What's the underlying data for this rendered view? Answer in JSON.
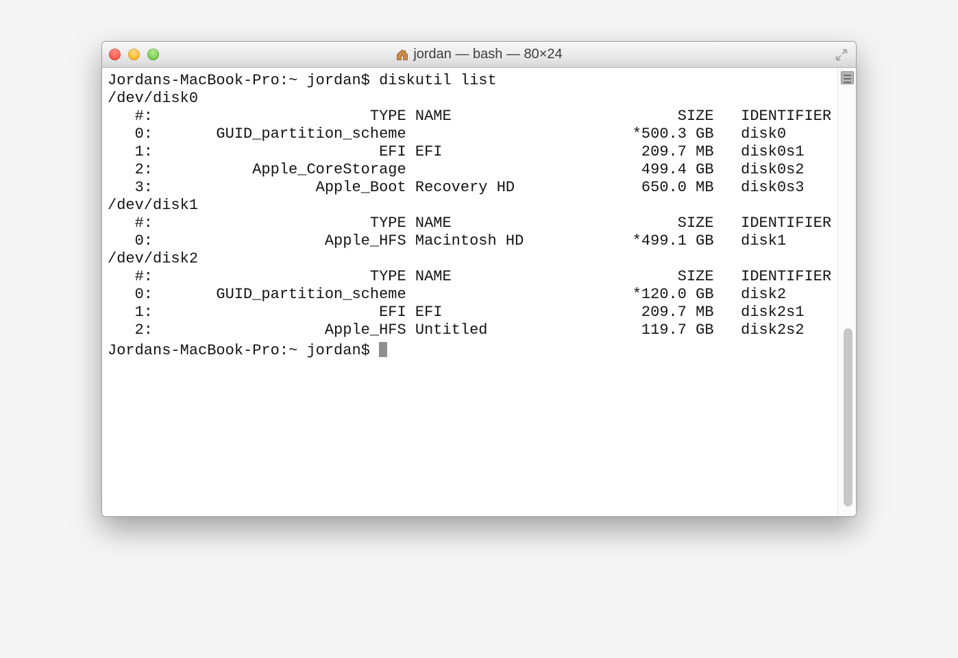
{
  "window": {
    "title": "jordan — bash — 80×24"
  },
  "terminal": {
    "prompt": "Jordans-MacBook-Pro:~ jordan$",
    "command": "diskutil list",
    "headers": {
      "num": "#:",
      "type": "TYPE",
      "name": "NAME",
      "size": "SIZE",
      "identifier": "IDENTIFIER"
    },
    "disks": [
      {
        "device": "/dev/disk0",
        "rows": [
          {
            "num": "0:",
            "type": "GUID_partition_scheme",
            "name": "",
            "size_prefix": "*",
            "size": "500.3 GB",
            "identifier": "disk0"
          },
          {
            "num": "1:",
            "type": "EFI",
            "name": "EFI",
            "size_prefix": " ",
            "size": "209.7 MB",
            "identifier": "disk0s1"
          },
          {
            "num": "2:",
            "type": "Apple_CoreStorage",
            "name": "",
            "size_prefix": " ",
            "size": "499.4 GB",
            "identifier": "disk0s2"
          },
          {
            "num": "3:",
            "type": "Apple_Boot",
            "name": "Recovery HD",
            "size_prefix": " ",
            "size": "650.0 MB",
            "identifier": "disk0s3"
          }
        ]
      },
      {
        "device": "/dev/disk1",
        "rows": [
          {
            "num": "0:",
            "type": "Apple_HFS",
            "name": "Macintosh HD",
            "size_prefix": "*",
            "size": "499.1 GB",
            "identifier": "disk1"
          }
        ]
      },
      {
        "device": "/dev/disk2",
        "rows": [
          {
            "num": "0:",
            "type": "GUID_partition_scheme",
            "name": "",
            "size_prefix": "*",
            "size": "120.0 GB",
            "identifier": "disk2"
          },
          {
            "num": "1:",
            "type": "EFI",
            "name": "EFI",
            "size_prefix": " ",
            "size": "209.7 MB",
            "identifier": "disk2s1"
          },
          {
            "num": "2:",
            "type": "Apple_HFS",
            "name": "Untitled",
            "size_prefix": " ",
            "size": "119.7 GB",
            "identifier": "disk2s2"
          }
        ]
      }
    ]
  }
}
